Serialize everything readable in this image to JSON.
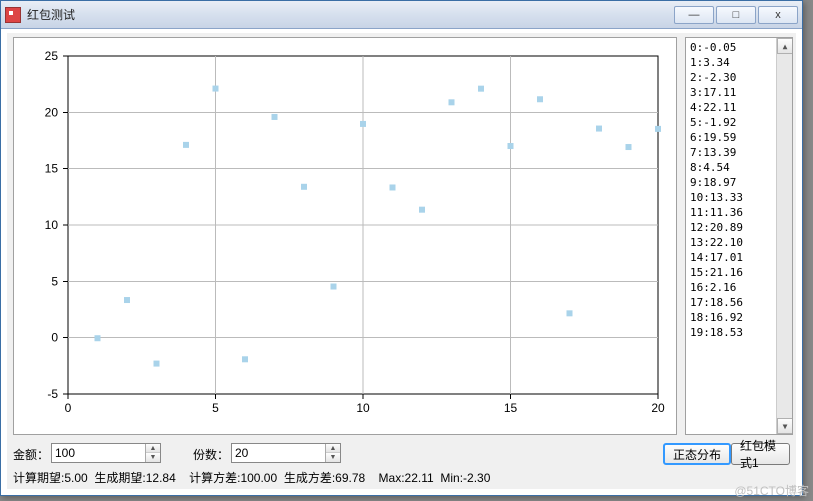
{
  "title": "红包测试",
  "win_buttons": {
    "min": "—",
    "max": "□",
    "close": "x"
  },
  "chart_data": {
    "type": "scatter",
    "x": [
      1,
      2,
      3,
      4,
      5,
      6,
      7,
      8,
      9,
      10,
      11,
      12,
      13,
      14,
      15,
      16,
      17,
      18,
      19,
      20
    ],
    "y": [
      -0.05,
      3.34,
      -2.3,
      17.11,
      22.11,
      -1.92,
      19.59,
      13.39,
      4.54,
      18.97,
      13.33,
      11.36,
      20.89,
      22.1,
      17.01,
      21.16,
      2.16,
      18.56,
      16.92,
      18.53
    ],
    "xlim": [
      0,
      20
    ],
    "ylim": [
      -5,
      25
    ],
    "xticks": [
      0,
      5,
      10,
      15,
      20
    ],
    "yticks": [
      -5,
      0,
      5,
      10,
      15,
      20,
      25
    ],
    "point_color": "#a9d3ea"
  },
  "list_items": [
    "0:-0.05",
    "1:3.34",
    "2:-2.30",
    "3:17.11",
    "4:22.11",
    "5:-1.92",
    "6:19.59",
    "7:13.39",
    "8:4.54",
    "9:18.97",
    "10:13.33",
    "11:11.36",
    "12:20.89",
    "13:22.10",
    "14:17.01",
    "15:21.16",
    "16:2.16",
    "17:18.56",
    "18:16.92",
    "19:18.53"
  ],
  "inputs": {
    "amount_label": "金额：",
    "amount_value": "100",
    "count_label": "份数：",
    "count_value": "20"
  },
  "buttons": {
    "normal_dist": "正态分布",
    "mode1": "红包模式1"
  },
  "status": {
    "calc_exp_label": "计算期望:",
    "calc_exp_value": "5.00",
    "gen_exp_label": "生成期望:",
    "gen_exp_value": "12.84",
    "calc_var_label": "计算方差:",
    "calc_var_value": "100.00",
    "gen_var_label": "生成方差:",
    "gen_var_value": "69.78",
    "max_label": "Max:",
    "max_value": "22.11",
    "min_label": "Min:",
    "min_value": "-2.30"
  },
  "watermark": "@51CTO博客"
}
